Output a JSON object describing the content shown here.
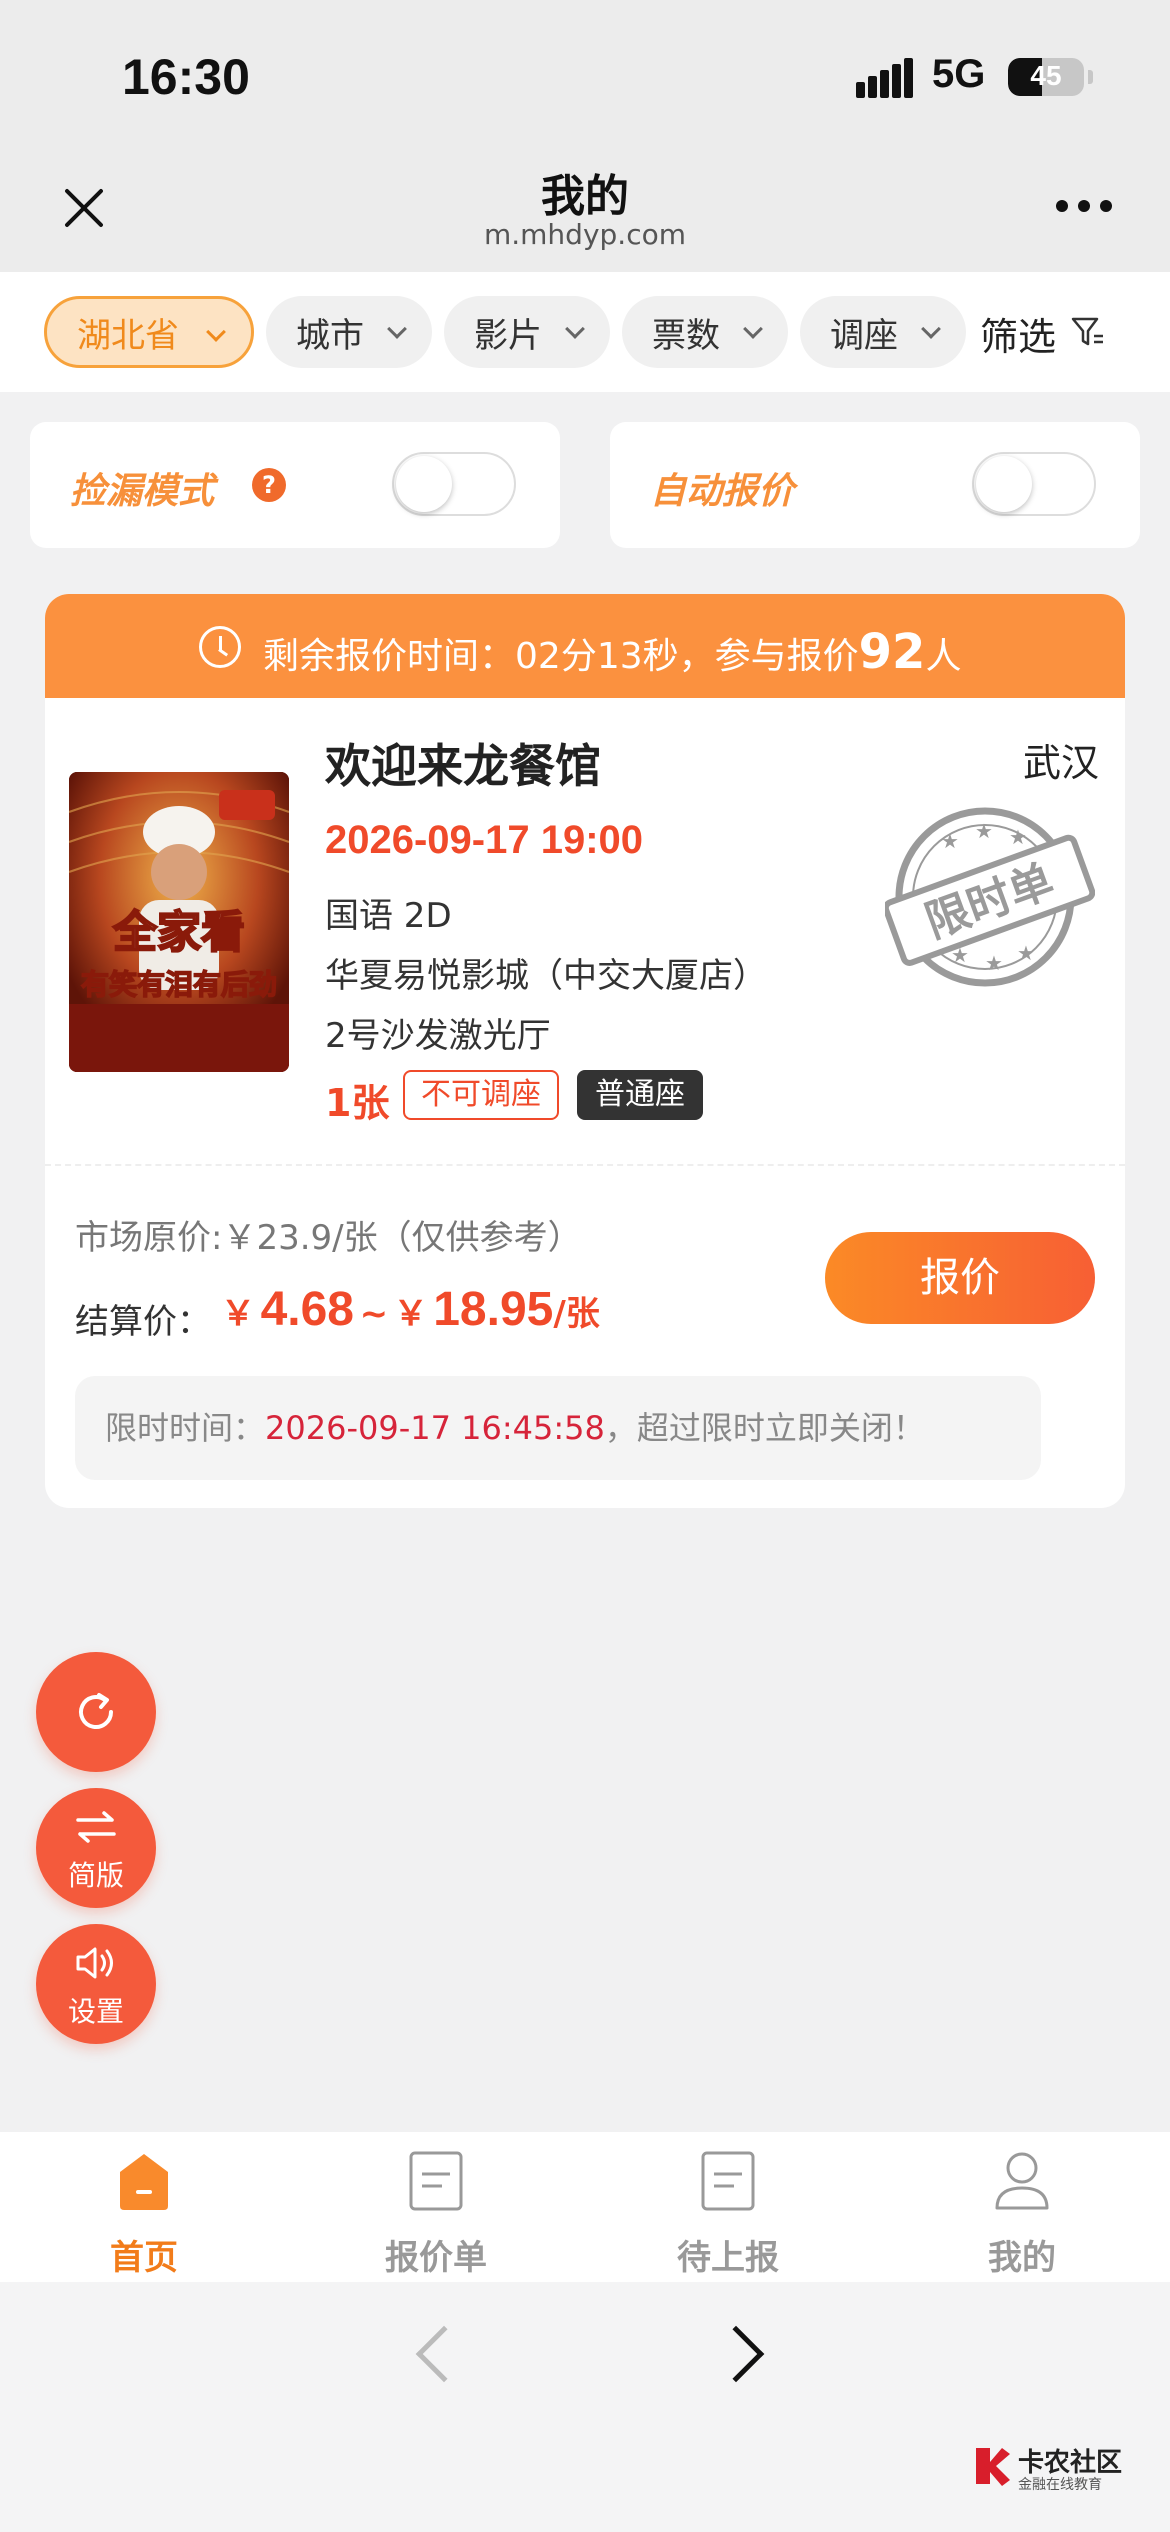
{
  "status_bar": {
    "time": "16:30",
    "network": "5G",
    "battery_level": 45
  },
  "nav": {
    "title": "我的",
    "url": "m.mhdyp.com"
  },
  "filters": {
    "chips": [
      "湖北省",
      "城市",
      "影片",
      "票数",
      "调座"
    ],
    "active_chip": "湖北省",
    "filter_label": "筛选"
  },
  "toggles": {
    "pick_mode": {
      "label": "捡漏模式",
      "help": "?",
      "on": false
    },
    "auto_quote": {
      "label": "自动报价",
      "on": false
    }
  },
  "order": {
    "header": {
      "remaining_label": "剩余报价时间：",
      "remaining_time": "02分13秒",
      "participants_prefix": "，参与报价",
      "participants_count": "92",
      "participants_suffix": "人"
    },
    "poster": {
      "line1": "全家看",
      "line2": "有笑有泪有后劲"
    },
    "movie_title": "欢迎来龙餐馆",
    "city": "武汉",
    "showtime": "2026-09-17 19:00",
    "language_format": "国语 2D",
    "cinema": "华夏易悦影城（中交大厦店）",
    "hall": "2号沙发激光厅",
    "ticket_count": "1张",
    "tags": [
      "不可调座",
      "普通座"
    ],
    "stamp_text": "限时单",
    "market_price": "市场原价:￥23.9/张（仅供参考）",
    "settle_label": "结算价：",
    "settle_currency": "￥",
    "settle_min": "4.68",
    "settle_sep": "~",
    "settle_max": "18.95",
    "settle_unit": "/张",
    "quote_button": "报价",
    "limit_label": "限时时间：",
    "limit_time": "2026-09-17 16:45:58",
    "limit_note": "，超过限时立即关闭！"
  },
  "fabs": [
    {
      "label": "",
      "icon": "refresh-icon"
    },
    {
      "label": "简版",
      "icon": "swap-icon"
    },
    {
      "label": "设置",
      "icon": "speaker-icon"
    }
  ],
  "tabs": [
    {
      "label": "首页",
      "icon": "home-icon",
      "active": true
    },
    {
      "label": "报价单",
      "icon": "document-icon",
      "active": false
    },
    {
      "label": "待上报",
      "icon": "document-icon",
      "active": false
    },
    {
      "label": "我的",
      "icon": "user-icon",
      "active": false
    }
  ],
  "watermark": {
    "text": "卡农社区",
    "sub": "金融在线教育"
  },
  "colors": {
    "accent": "#fb913f",
    "price_red": "#f04a2a",
    "fab_red": "#f45a3c",
    "tab_active": "#f27c1a"
  }
}
